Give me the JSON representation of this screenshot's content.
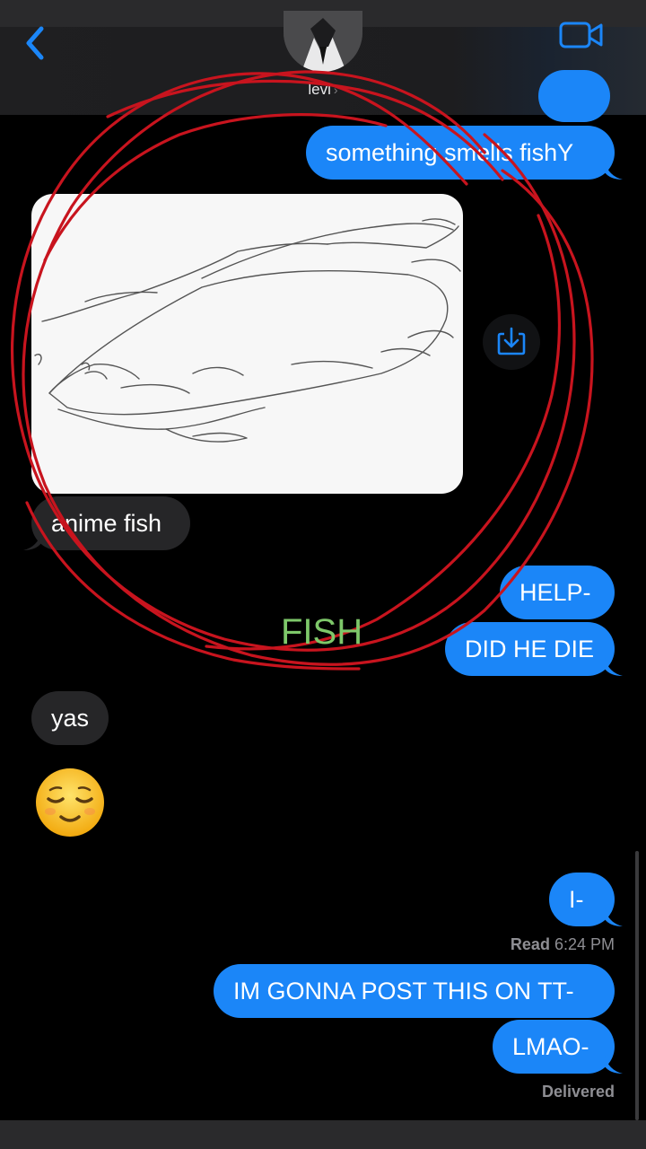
{
  "header": {
    "contact_name": "levi",
    "name_chevron": "›",
    "icons": {
      "back": "chevron-left-icon",
      "video": "video-camera-icon",
      "avatar": "contact-avatar"
    }
  },
  "messages": [
    {
      "from": "me",
      "text": "something smells fishY"
    },
    {
      "from": "them",
      "type": "image",
      "description_icon": "fish-sketch"
    },
    {
      "from": "them",
      "text": "anime fish"
    },
    {
      "from": "me",
      "text": "HELP-"
    },
    {
      "from": "me",
      "text": "DID HE DIE"
    },
    {
      "from": "them",
      "text": "yas"
    },
    {
      "from": "them",
      "type": "emoji",
      "emoji": "😌"
    },
    {
      "from": "me",
      "text": "I-"
    },
    {
      "from": "me",
      "text": "IM GONNA POST THIS ON TT-"
    },
    {
      "from": "me",
      "text": "LMAO-"
    }
  ],
  "read_receipt": {
    "label": "Read",
    "time": "6:24 PM"
  },
  "delivered_label": "Delivered",
  "overlay": {
    "annotation_text": "FISH",
    "annotation_color": "#7ec86a",
    "circle_color": "#c8141e"
  },
  "colors": {
    "my_bubble": "#1b86f8",
    "their_bubble": "#262628",
    "background": "#000000"
  }
}
